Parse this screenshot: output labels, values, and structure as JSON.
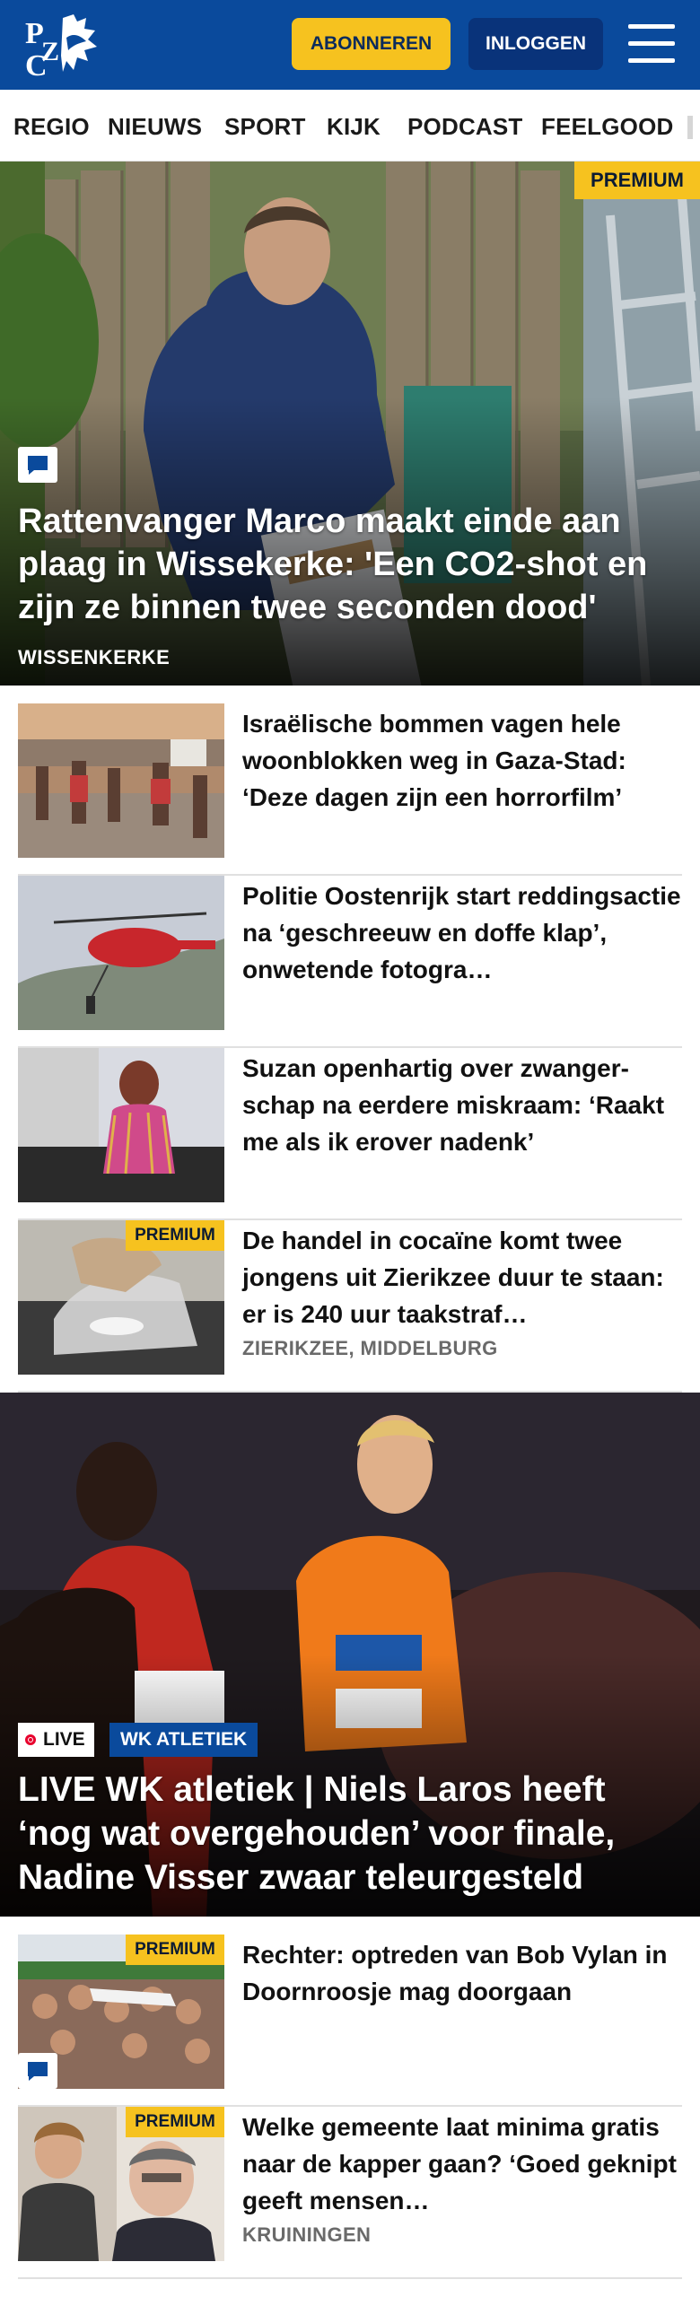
{
  "header": {
    "subscribe_label": "ABONNEREN",
    "login_label": "INLOGGEN",
    "brand_colors": {
      "primary": "#0a4a9c",
      "accent": "#f6c21f",
      "login_bg": "#09337a"
    }
  },
  "nav": {
    "items": [
      "REGIO",
      "NIEUWS",
      "SPORT",
      "KIJK",
      "PODCAST",
      "FEELGOOD"
    ]
  },
  "hero": {
    "badge": "PREMIUM",
    "title": "Rattenvanger Marco maakt einde aan plaag in Wissekerke: 'Een CO2-shot en zijn ze binnen twee seconden dood'",
    "location": "WISSENKERKE",
    "has_comments_icon": true
  },
  "articles": [
    {
      "title": "Israëlische bommen vagen hele woonblokken weg in Gaza-Stad: ‘Deze dagen zijn een horrorfilm’"
    },
    {
      "title": "Politie Oostenrijk start reddingsactie na ‘geschreeuw en doffe klap’, onwetende fotogra…"
    },
    {
      "title": "Suzan openhartig over zwanger­schap na eerdere miskraam: ‘Raakt me als ik erover nadenk’"
    },
    {
      "title": "De handel in cocaïne komt twee jongens uit Zierikzee duur te staan: er is 240 uur taakstraf…",
      "badge": "PREMIUM",
      "location": "ZIERIKZEE, MIDDELBURG"
    }
  ],
  "live": {
    "live_label": "LIVE",
    "topic_label": "WK ATLETIEK",
    "title": "LIVE WK atletiek | Niels Laros heeft ‘nog wat overgehouden’ voor finale, Nadine Visser zwaar teleurgesteld"
  },
  "articles2": [
    {
      "title": "Rechter: optreden van Bob Vylan in Doornroosje mag doorgaan",
      "badge": "PREMIUM",
      "has_comments_icon": true
    },
    {
      "title": "Welke gemeente laat minima gratis naar de kapper gaan? ‘Goed geknipt geeft mensen…",
      "badge": "PREMIUM",
      "location": "KRUININGEN"
    }
  ]
}
